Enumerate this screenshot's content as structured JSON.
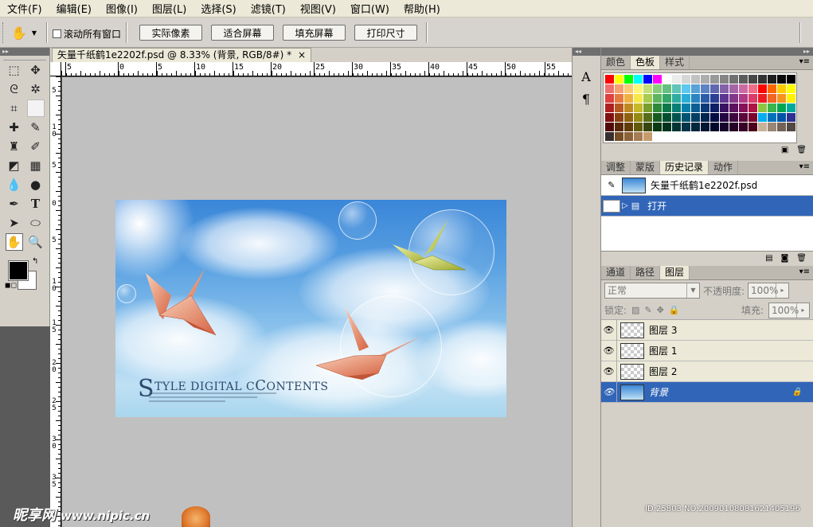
{
  "menu": [
    "文件(F)",
    "编辑(E)",
    "图像(I)",
    "图层(L)",
    "选择(S)",
    "滤镜(T)",
    "视图(V)",
    "窗口(W)",
    "帮助(H)"
  ],
  "options": {
    "checkbox_label": "滚动所有窗口",
    "buttons": [
      "实际像素",
      "适合屏幕",
      "填充屏幕",
      "打印尺寸"
    ]
  },
  "document": {
    "tab_title": "矢量千纸鹤1e2202f.psd @ 8.33% (背景, RGB/8#) *",
    "tab_close": "×",
    "ruler_h": [
      "5",
      "0",
      "5",
      "10",
      "15",
      "20",
      "25",
      "30",
      "35",
      "40",
      "45",
      "50",
      "55"
    ],
    "ruler_v": [
      "5",
      "1\n0",
      "5",
      "0",
      "5",
      "1\n0",
      "1\n5",
      "2\n0",
      "2\n5",
      "3\n0",
      "3\n5",
      "4"
    ],
    "artwork": {
      "title_initial_s": "S",
      "title_rest": "TYLE DIGITAL C",
      "title_initial_c": "C",
      "title_tail": "ONTENTS"
    }
  },
  "dock": {
    "collapse": "◂◂",
    "icons": [
      "character-icon",
      "paragraph-icon"
    ]
  },
  "panels": {
    "swatch_tabs": [
      "颜色",
      "色板",
      "样式"
    ],
    "swatch_active": 1,
    "swatches": [
      "#ff0000",
      "#ffff00",
      "#00ff00",
      "#00ffff",
      "#0000ff",
      "#ff00ff",
      "#ffffff",
      "#ebebeb",
      "#d6d6d6",
      "#c2c2c2",
      "#adadad",
      "#999999",
      "#858585",
      "#707070",
      "#5c5c5c",
      "#474747",
      "#333333",
      "#1f1f1f",
      "#0a0a0a",
      "#000000",
      "#f07070",
      "#f5a070",
      "#faca74",
      "#fff576",
      "#c4df78",
      "#87cc7c",
      "#65c081",
      "#60c4b8",
      "#5dc8ed",
      "#5aa1d6",
      "#5c84c4",
      "#6069b0",
      "#8462a8",
      "#a465a6",
      "#cc6aa4",
      "#f06d8a",
      "#ff0000",
      "#ff6600",
      "#ffcc00",
      "#ffff00",
      "#e04040",
      "#e87a40",
      "#f0b040",
      "#f6e84a",
      "#a8cc50",
      "#5eb55e",
      "#34a869",
      "#2eac9f",
      "#2aaed8",
      "#2a85c2",
      "#2a5ea8",
      "#2c3f96",
      "#5c3690",
      "#83388a",
      "#b03a86",
      "#dc3c6c",
      "#ed1c24",
      "#f26522",
      "#f7941d",
      "#fff200",
      "#b02020",
      "#b85820",
      "#c08820",
      "#c6b828",
      "#7a9e2c",
      "#2e8a3a",
      "#0c7a48",
      "#087e74",
      "#0880aa",
      "#0a5e92",
      "#0a3a78",
      "#0c1e66",
      "#3a1262",
      "#5c125e",
      "#86125a",
      "#ae1444",
      "#8dc63f",
      "#39b54a",
      "#00a651",
      "#00a99d",
      "#801010",
      "#884010",
      "#906010",
      "#968a14",
      "#566e1a",
      "#165c22",
      "#005030",
      "#00544e",
      "#005472",
      "#003e62",
      "#002450",
      "#000c44",
      "#240642",
      "#3e063e",
      "#5c063c",
      "#7a062e",
      "#00aeef",
      "#0072bc",
      "#0054a6",
      "#2e3192",
      "#500808",
      "#582808",
      "#603c08",
      "#645a0c",
      "#36460e",
      "#0a3a14",
      "#00321e",
      "#003432",
      "#003448",
      "#00263e",
      "#001632",
      "#00062a",
      "#16022a",
      "#260228",
      "#380226",
      "#4c021c",
      "#c7b299",
      "#998675",
      "#736357",
      "#534741",
      "#362f2d",
      "#754c24",
      "#8c6239",
      "#a67c52",
      "#c69c6d",
      "#ffffff",
      "#ffffff",
      "#ffffff",
      "#ffffff",
      "#ffffff",
      "#ffffff",
      "#ffffff",
      "#ffffff",
      "#ffffff",
      "#ffffff",
      "#ffffff",
      "#ffffff",
      "#ffffff",
      "#ffffff",
      "#ffffff"
    ],
    "history_tabs": [
      "调整",
      "蒙版",
      "历史记录",
      "动作"
    ],
    "history_active": 2,
    "history_snapshot": "矢量千纸鹤1e2202f.psd",
    "history_step": "打开",
    "layers_tabs": [
      "通道",
      "路径",
      "图层"
    ],
    "layers_active": 2,
    "blend_mode": "正常",
    "opacity_label": "不透明度:",
    "opacity_value": "100%",
    "lock_label": "锁定:",
    "fill_label": "填充:",
    "fill_value": "100%",
    "layers": [
      "图层 3",
      "图层 1",
      "图层 2",
      "背景"
    ],
    "selected_layer": 3
  },
  "watermark": {
    "brand": "昵享网",
    "url": "www.nipic.cn",
    "id_stamp": "ID:25803 NO:20090108081621405196"
  }
}
